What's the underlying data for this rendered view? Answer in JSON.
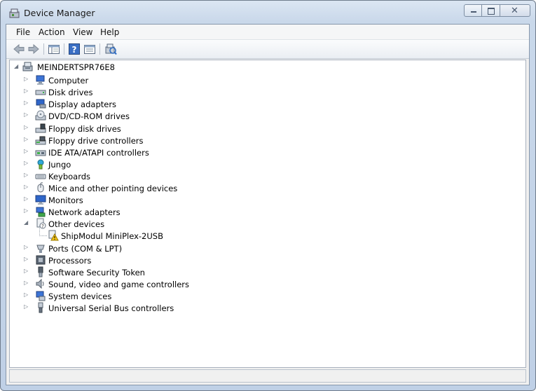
{
  "window": {
    "title": "Device Manager"
  },
  "menu": {
    "items": [
      "File",
      "Action",
      "View",
      "Help"
    ]
  },
  "toolbar": {
    "buttons": [
      "back-icon",
      "forward-icon",
      "show-hide-tree-icon",
      "help-icon",
      "properties-icon",
      "scan-hardware-icon"
    ]
  },
  "tree": {
    "root": "MEINDERTSPR76E8",
    "items": [
      {
        "label": "Computer",
        "icon": "computer-icon"
      },
      {
        "label": "Disk drives",
        "icon": "disk-drive-icon"
      },
      {
        "label": "Display adapters",
        "icon": "display-adapter-icon"
      },
      {
        "label": "DVD/CD-ROM drives",
        "icon": "dvd-drive-icon"
      },
      {
        "label": "Floppy disk drives",
        "icon": "floppy-disk-icon"
      },
      {
        "label": "Floppy drive controllers",
        "icon": "floppy-controller-icon"
      },
      {
        "label": "IDE ATA/ATAPI controllers",
        "icon": "ide-controller-icon"
      },
      {
        "label": "Jungo",
        "icon": "jungo-icon"
      },
      {
        "label": "Keyboards",
        "icon": "keyboard-icon"
      },
      {
        "label": "Mice and other pointing devices",
        "icon": "mouse-icon"
      },
      {
        "label": "Monitors",
        "icon": "monitor-icon"
      },
      {
        "label": "Network adapters",
        "icon": "network-adapter-icon"
      },
      {
        "label": "Other devices",
        "icon": "other-devices-icon",
        "expanded": true
      },
      {
        "label": "ShipModul MiniPlex-2USB",
        "icon": "warning-device-icon",
        "child": true
      },
      {
        "label": "Ports (COM & LPT)",
        "icon": "port-icon"
      },
      {
        "label": "Processors",
        "icon": "processor-icon"
      },
      {
        "label": "Software Security Token",
        "icon": "security-token-icon"
      },
      {
        "label": "Sound, video and game controllers",
        "icon": "sound-icon"
      },
      {
        "label": "System devices",
        "icon": "system-devices-icon"
      },
      {
        "label": "Universal Serial Bus controllers",
        "icon": "usb-icon"
      }
    ]
  }
}
